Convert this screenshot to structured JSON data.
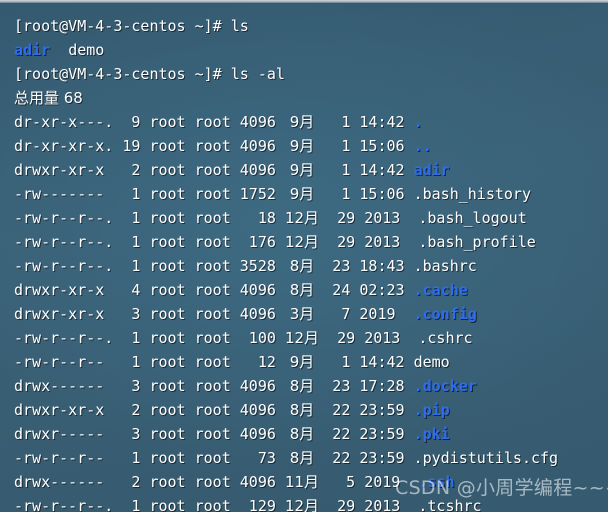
{
  "terminal": {
    "shell_prompt": "[root@VM-4-3-centos ~]#",
    "colors": {
      "background": "#3a6076",
      "foreground": "#ffffff",
      "directory": "#2f6df0",
      "watermark": "#ecf2f6"
    },
    "lines": [
      {
        "type": "prompt",
        "prompt": "[root@VM-4-3-centos ~]# ",
        "command": "ls"
      },
      {
        "type": "ls-short",
        "entries": [
          {
            "name": "adir",
            "kind": "dir"
          },
          {
            "name": "demo",
            "kind": "file"
          }
        ]
      },
      {
        "type": "prompt",
        "prompt": "[root@VM-4-3-centos ~]# ",
        "command": "ls -al"
      },
      {
        "type": "total",
        "text": "总用量 68"
      }
    ],
    "listing": [
      {
        "perm": "dr-xr-x---.",
        "links": "9",
        "owner": "root",
        "group": "root",
        "size": "4096",
        "month": "9月",
        "day": "1",
        "time": "14:42",
        "name": ".",
        "kind": "dir"
      },
      {
        "perm": "dr-xr-xr-x.",
        "links": "19",
        "owner": "root",
        "group": "root",
        "size": "4096",
        "month": "9月",
        "day": "1",
        "time": "15:06",
        "name": "..",
        "kind": "dir"
      },
      {
        "perm": "drwxr-xr-x",
        "links": "2",
        "owner": "root",
        "group": "root",
        "size": "4096",
        "month": "9月",
        "day": "1",
        "time": "14:42",
        "name": "adir",
        "kind": "dir"
      },
      {
        "perm": "-rw-------",
        "links": "1",
        "owner": "root",
        "group": "root",
        "size": "1752",
        "month": "9月",
        "day": "1",
        "time": "15:06",
        "name": ".bash_history",
        "kind": "file"
      },
      {
        "perm": "-rw-r--r--.",
        "links": "1",
        "owner": "root",
        "group": "root",
        "size": "18",
        "month": "12月",
        "day": "29",
        "time": "2013",
        "name": ".bash_logout",
        "kind": "file"
      },
      {
        "perm": "-rw-r--r--.",
        "links": "1",
        "owner": "root",
        "group": "root",
        "size": "176",
        "month": "12月",
        "day": "29",
        "time": "2013",
        "name": ".bash_profile",
        "kind": "file"
      },
      {
        "perm": "-rw-r--r--.",
        "links": "1",
        "owner": "root",
        "group": "root",
        "size": "3528",
        "month": "8月",
        "day": "23",
        "time": "18:43",
        "name": ".bashrc",
        "kind": "file"
      },
      {
        "perm": "drwxr-xr-x",
        "links": "4",
        "owner": "root",
        "group": "root",
        "size": "4096",
        "month": "8月",
        "day": "24",
        "time": "02:23",
        "name": ".cache",
        "kind": "dir"
      },
      {
        "perm": "drwxr-xr-x",
        "links": "3",
        "owner": "root",
        "group": "root",
        "size": "4096",
        "month": "3月",
        "day": "7",
        "time": "2019",
        "name": ".config",
        "kind": "dir"
      },
      {
        "perm": "-rw-r--r--.",
        "links": "1",
        "owner": "root",
        "group": "root",
        "size": "100",
        "month": "12月",
        "day": "29",
        "time": "2013",
        "name": ".cshrc",
        "kind": "file"
      },
      {
        "perm": "-rw-r--r--",
        "links": "1",
        "owner": "root",
        "group": "root",
        "size": "12",
        "month": "9月",
        "day": "1",
        "time": "14:42",
        "name": "demo",
        "kind": "file"
      },
      {
        "perm": "drwx------",
        "links": "3",
        "owner": "root",
        "group": "root",
        "size": "4096",
        "month": "8月",
        "day": "23",
        "time": "17:28",
        "name": ".docker",
        "kind": "dir"
      },
      {
        "perm": "drwxr-xr-x",
        "links": "2",
        "owner": "root",
        "group": "root",
        "size": "4096",
        "month": "8月",
        "day": "22",
        "time": "23:59",
        "name": ".pip",
        "kind": "dir"
      },
      {
        "perm": "drwxr-----",
        "links": "3",
        "owner": "root",
        "group": "root",
        "size": "4096",
        "month": "8月",
        "day": "22",
        "time": "23:59",
        "name": ".pki",
        "kind": "dir"
      },
      {
        "perm": "-rw-r--r--",
        "links": "1",
        "owner": "root",
        "group": "root",
        "size": "73",
        "month": "8月",
        "day": "22",
        "time": "23:59",
        "name": ".pydistutils.cfg",
        "kind": "file"
      },
      {
        "perm": "drwx------",
        "links": "2",
        "owner": "root",
        "group": "root",
        "size": "4096",
        "month": "11月",
        "day": "5",
        "time": "2019",
        "name": ".ssh",
        "kind": "dir"
      },
      {
        "perm": "-rw-r--r--.",
        "links": "1",
        "owner": "root",
        "group": "root",
        "size": "129",
        "month": "12月",
        "day": "29",
        "time": "2013",
        "name": ".tcshrc",
        "kind": "file"
      }
    ],
    "watermark": "CSDN @小周学编程~~~"
  }
}
